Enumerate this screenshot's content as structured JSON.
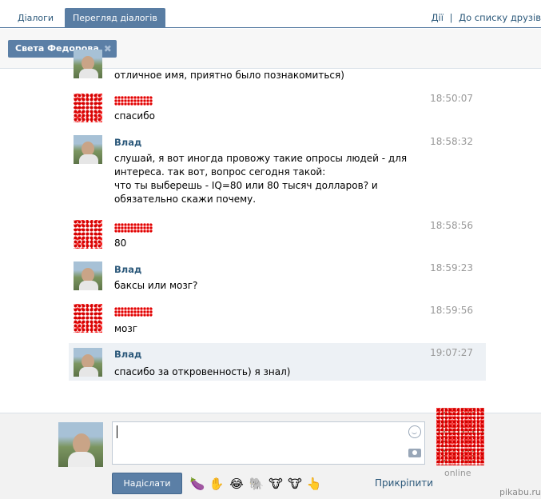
{
  "tabs": [
    {
      "label": "Діалоги"
    },
    {
      "label": "Перегляд діалогів"
    }
  ],
  "top_links": {
    "actions": "Дії",
    "separator": "|",
    "friends": "До списку друзів"
  },
  "recipient": {
    "name": "Света Федорова",
    "remove_glyph": "✖"
  },
  "messages": [
    {
      "author": "",
      "time": "",
      "text": "отличное имя, приятно было познакомиться)"
    },
    {
      "author": "",
      "time": "18:50:07",
      "text": "спасибо"
    },
    {
      "author": "Влад",
      "time": "18:58:32",
      "text": "слушай, я вот иногда провожу такие опросы людей - для интереса. так вот, вопрос сегодня такой:\nчто ты выберешь - IQ=80 или 80 тысяч долларов? и обязательно скажи почему."
    },
    {
      "author": "",
      "time": "18:58:56",
      "text": "80"
    },
    {
      "author": "Влад",
      "time": "18:59:23",
      "text": "баксы или мозг?"
    },
    {
      "author": "",
      "time": "18:59:56",
      "text": "мозг"
    },
    {
      "author": "Влад",
      "time": "19:07:27",
      "text": "спасибо за откровенность) я знал)"
    }
  ],
  "composer": {
    "input_value": "",
    "send_label": "Надіслати",
    "attach_label": "Прикріпити",
    "emojis": [
      "🍆",
      "✋",
      "😂",
      "🐘",
      "🐮",
      "🐮",
      "👆"
    ],
    "peer_status": "online"
  },
  "watermark": "pikabu.ru"
}
